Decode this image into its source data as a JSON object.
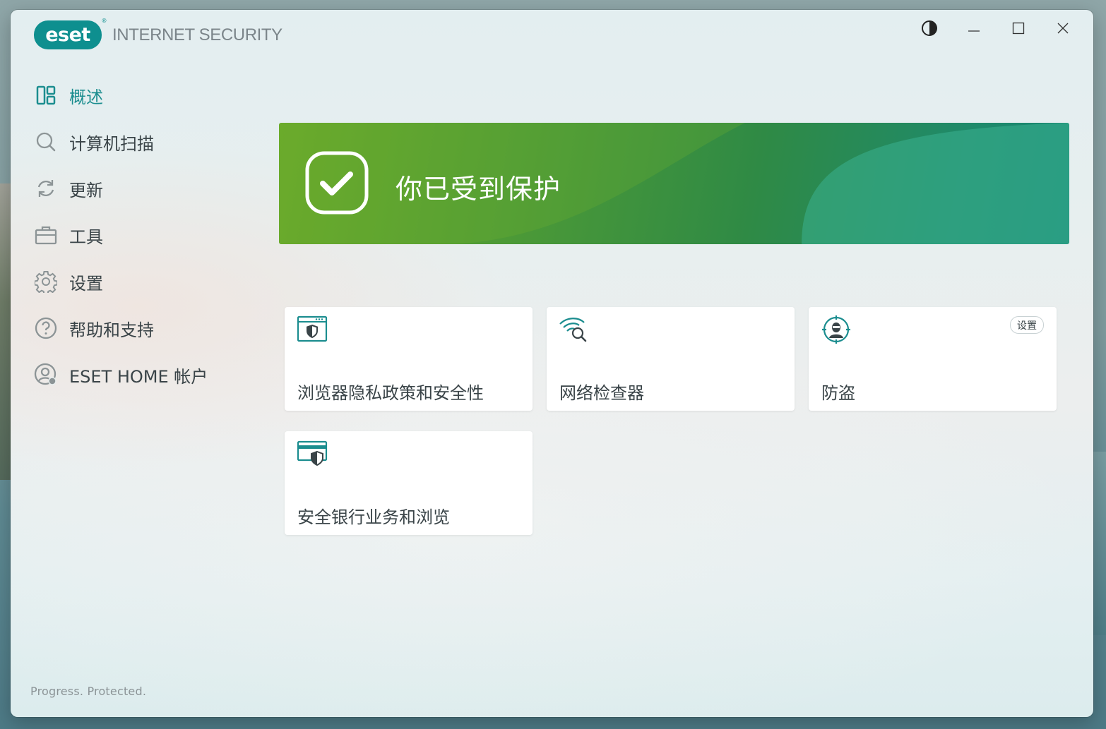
{
  "app": {
    "logo_text": "eset",
    "logo_reg": "®",
    "product_name": "INTERNET SECURITY"
  },
  "window_controls": [
    "contrast-icon",
    "minimize-icon",
    "maximize-icon",
    "close-icon"
  ],
  "sidebar": {
    "items": [
      {
        "label": "概述",
        "icon": "overview-icon",
        "active": true
      },
      {
        "label": "计算机扫描",
        "icon": "search-icon",
        "active": false
      },
      {
        "label": "更新",
        "icon": "refresh-icon",
        "active": false
      },
      {
        "label": "工具",
        "icon": "briefcase-icon",
        "active": false
      },
      {
        "label": "设置",
        "icon": "gear-icon",
        "active": false
      },
      {
        "label": "帮助和支持",
        "icon": "help-icon",
        "active": false
      },
      {
        "label": "ESET HOME 帐户",
        "icon": "account-icon",
        "active": false
      }
    ],
    "tagline": "Progress. Protected."
  },
  "status": {
    "title": "你已受到保护",
    "icon": "check-icon"
  },
  "cards": [
    {
      "label": "浏览器隐私政策和安全性",
      "icon": "browser-shield-icon"
    },
    {
      "label": "网络检查器",
      "icon": "wifi-search-icon"
    },
    {
      "label": "防盗",
      "icon": "anti-theft-icon",
      "button": "设置"
    },
    {
      "label": "安全银行业务和浏览",
      "icon": "card-shield-icon"
    }
  ],
  "colors": {
    "accent": "#1b8d8f",
    "brand": "#0e8f8f",
    "banner_start": "#6aa92a",
    "banner_end": "#178674"
  }
}
